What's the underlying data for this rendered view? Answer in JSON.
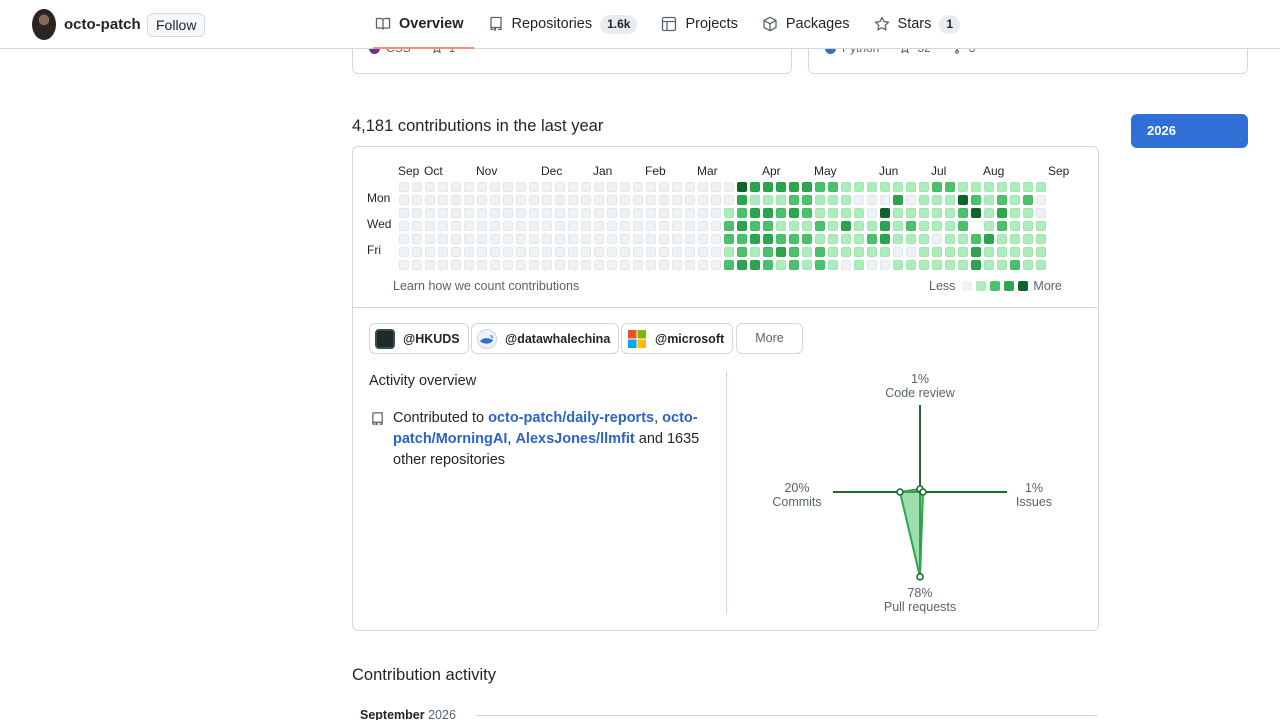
{
  "profile": {
    "username": "octo-patch",
    "follow_label": "Follow"
  },
  "tabs": [
    {
      "label": "Overview",
      "icon": "book-icon"
    },
    {
      "label": "Repositories",
      "icon": "repo-icon",
      "count": "1.6k"
    },
    {
      "label": "Projects",
      "icon": "table-icon"
    },
    {
      "label": "Packages",
      "icon": "package-icon"
    },
    {
      "label": "Stars",
      "icon": "star-icon",
      "count": "1"
    }
  ],
  "pinned": {
    "left": {
      "language": "CSS",
      "language_color": "#663399",
      "stars": "1"
    },
    "right": {
      "language": "Python",
      "language_color": "#3572a5",
      "stars": "32",
      "forks": "3"
    }
  },
  "contributions": {
    "title": "4,181 contributions in the last year",
    "year": "2026",
    "months": [
      "Sep",
      "Oct",
      "Nov",
      "Dec",
      "Jan",
      "Feb",
      "Mar",
      "Apr",
      "May",
      "Jun",
      "Jul",
      "Aug",
      "Sep"
    ],
    "days": [
      "Mon",
      "Wed",
      "Fri"
    ],
    "learn_link": "Learn how we count contributions",
    "legend_less": "Less",
    "legend_more": "More",
    "levels_colors": [
      "#eff2f5",
      "#aceebb",
      "#4ac26b",
      "#2da44e",
      "#116329"
    ],
    "grid": [
      "00000000000000000000000000433333221111111221111111",
      "00000000000000000000000000311122111000301114212120",
      "00000000000000000000000001233232111104111112413110",
      "00000000000000000000000002322111213113121112512111",
      "00000000000000000000000002233222111123111011231111",
      "00000000000000000000000001212321211111001111311111",
      "00000000000000000000000002332121210100111111311211"
    ]
  },
  "orgs": [
    {
      "label": "@HKUDS"
    },
    {
      "label": "@datawhalechina"
    },
    {
      "label": "@microsoft"
    }
  ],
  "more_label": "More",
  "activity": {
    "title": "Activity overview",
    "prefix": "Contributed to",
    "repo1": "octo-patch/daily-reports",
    "repo2": "octo-patch/MorningAI",
    "repo3": "AlexsJones/llmfit",
    "suffix": "and 1635 other repositories"
  },
  "radar": {
    "code_review": {
      "pct": "1%",
      "label": "Code review",
      "value": 1
    },
    "issues": {
      "pct": "1%",
      "label": "Issues",
      "value": 1
    },
    "pull_requests": {
      "pct": "78%",
      "label": "Pull requests",
      "value": 78
    },
    "commits": {
      "pct": "20%",
      "label": "Commits",
      "value": 20
    }
  },
  "contribution_activity": {
    "title": "Contribution activity",
    "month": "September",
    "year": "2026"
  }
}
